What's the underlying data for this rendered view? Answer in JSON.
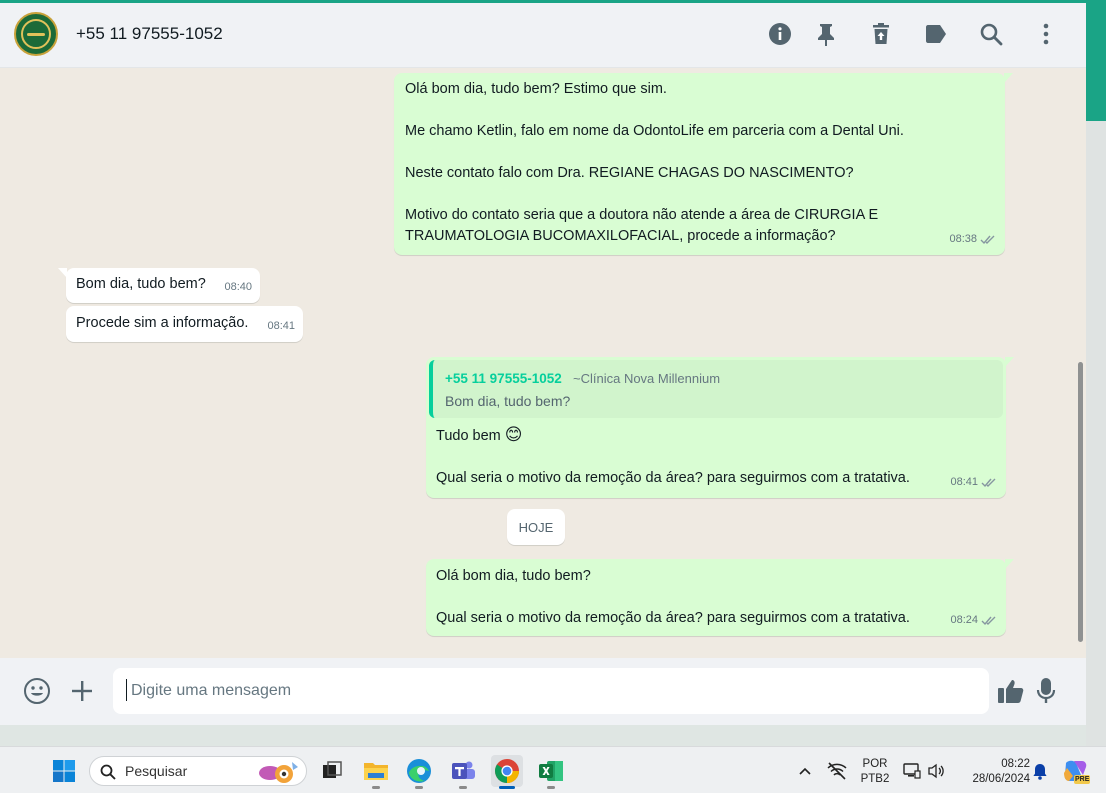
{
  "header": {
    "contact_name": "+55 11 97555-1052",
    "icons": [
      "info-icon",
      "pin-icon",
      "delete-icon",
      "label-icon",
      "search-icon",
      "menu-icon"
    ]
  },
  "messages": {
    "m1": {
      "direction": "out",
      "lines": [
        "Olá bom dia, tudo bem? Estimo que sim.",
        "Me chamo Ketlin, falo em nome da OdontoLife em parceria com a Dental Uni.",
        "Neste contato falo com Dra. REGIANE CHAGAS DO NASCIMENTO?",
        "Motivo do contato seria que a doutora não atende a área de CIRURGIA E",
        "TRAUMATOLOGIA BUCOMAXILOFACIAL, procede a informação?"
      ],
      "time": "08:38"
    },
    "m2": {
      "direction": "in",
      "text": "Bom dia, tudo bem?",
      "time": "08:40"
    },
    "m3": {
      "direction": "in",
      "text": "Procede sim a informação.",
      "time": "08:41"
    },
    "m4": {
      "direction": "out",
      "quote": {
        "author": "+55 11 97555-1052",
        "alias": "~Clínica Nova Millennium",
        "text": "Bom dia, tudo bem?"
      },
      "line1": "Tudo bem",
      "emoji": "😊",
      "line2": "Qual seria o motivo da remoção da área? para seguirmos com a tratativa.",
      "time": "08:41"
    },
    "date_divider": "HOJE",
    "m5": {
      "direction": "out",
      "line1": "Olá bom dia, tudo bem?",
      "line2": "Qual seria o motivo da remoção da área? para seguirmos com a tratativa.",
      "time": "08:24"
    }
  },
  "composer": {
    "placeholder": "Digite uma mensagem",
    "value": ""
  },
  "taskbar": {
    "search_label": "Pesquisar",
    "language_top": "POR",
    "language_bottom": "PTB2",
    "time": "08:22",
    "date": "28/06/2024",
    "copilot_badge": "PRE"
  },
  "colors": {
    "accent": "#1aa486",
    "outgoing_bubble": "#d9fdd3",
    "incoming_bubble": "#ffffff",
    "chat_background": "#efeae2",
    "quote_author": "#06cf9c"
  }
}
